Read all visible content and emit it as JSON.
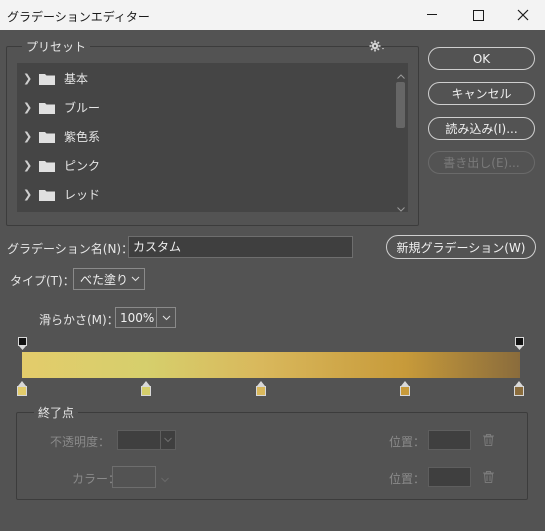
{
  "window": {
    "title": "グラデーションエディター"
  },
  "preset": {
    "legend": "プリセット",
    "items": [
      {
        "label": "基本"
      },
      {
        "label": "ブルー"
      },
      {
        "label": "紫色系"
      },
      {
        "label": "ピンク"
      },
      {
        "label": "レッド"
      }
    ]
  },
  "buttons": {
    "ok": "OK",
    "cancel": "キャンセル",
    "load": "読み込み(I)...",
    "save": "書き出し(E)..."
  },
  "name": {
    "label": "グラデーション名(N)：",
    "value": "カスタム",
    "new_button": "新規グラデーション(W)"
  },
  "type": {
    "label": "タイプ(T)：",
    "value": "べた塗り"
  },
  "smoothness": {
    "label": "滑らかさ(M)：",
    "value": "100%"
  },
  "gradient": {
    "color_stops": [
      {
        "position": 0,
        "color": "#e3cc6b"
      },
      {
        "position": 0.25,
        "color": "#d6cf6c"
      },
      {
        "position": 0.48,
        "color": "#d9b85c"
      },
      {
        "position": 0.77,
        "color": "#c79a3a"
      },
      {
        "position": 1.0,
        "color": "#8a6c3c"
      }
    ],
    "opacity_stops": [
      {
        "position": 0,
        "opacity": 1
      },
      {
        "position": 1.0,
        "opacity": 1
      }
    ]
  },
  "end_point": {
    "legend": "終了点",
    "opacity_label": "不透明度：",
    "color_label": "カラー：",
    "location_label": "位置："
  },
  "colors": {
    "background": "#535353",
    "titlebar": "#f3f3f3",
    "list_bg": "#454545"
  }
}
